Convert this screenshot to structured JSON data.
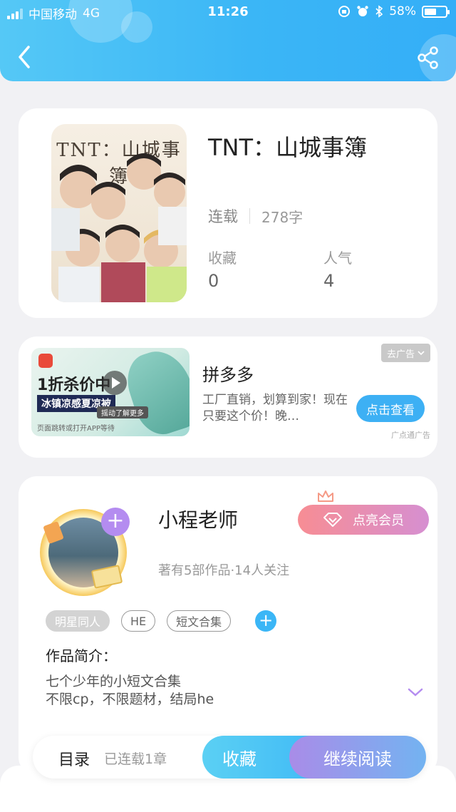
{
  "status_bar": {
    "carrier": "中国移动",
    "network": "4G",
    "time": "11:26",
    "battery": "58%",
    "battery_level": 0.58
  },
  "nav": {
    "back_icon": "chevron-left-icon",
    "share_icon": "share-icon"
  },
  "book": {
    "cover_text": "TNT：山城事簿",
    "title": "TNT：山城事簿",
    "status": "连载",
    "word_count": "278字",
    "stats": [
      {
        "label": "收藏",
        "value": "0"
      },
      {
        "label": "人气",
        "value": "4"
      }
    ]
  },
  "ad": {
    "image_headline": "1折杀价中",
    "image_band": "冰镇凉感夏凉被",
    "image_sub": "摇动了解更多",
    "image_foot": "页面跳转或打开APP等待",
    "close_label": "去广告",
    "advertiser": "拼多多",
    "description": "工厂直销，划算到家！现在只要这个价！晚…",
    "cta": "点击查看",
    "source": "广点通广告"
  },
  "author": {
    "name": "小程老师",
    "meta": "著有5部作品·14人关注",
    "vip_label": "点亮会员",
    "tags": [
      "明星同人",
      "HE",
      "短文合集"
    ],
    "intro_label": "作品简介：",
    "intro_lines": [
      "七个少年的小短文合集",
      "不限cp，不限题材，结局he"
    ]
  },
  "bottom": {
    "toc_label": "目录",
    "serial_status": "已连载1章",
    "favorite_label": "收藏",
    "read_label": "继续阅读"
  },
  "colors": {
    "accent_blue": "#3bb6f6",
    "accent_purple": "#b48cf0",
    "vip_pink": "#f78d94"
  }
}
